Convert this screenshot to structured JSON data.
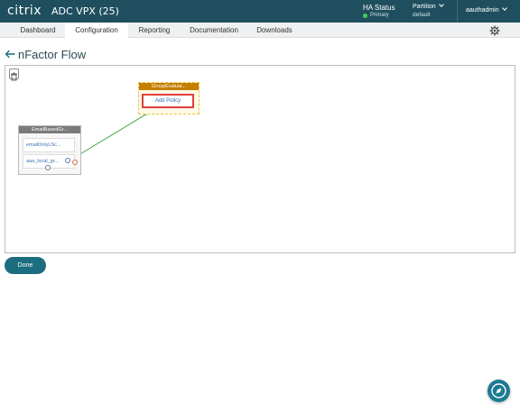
{
  "header": {
    "brand": "citrix",
    "product": "ADC VPX (25)",
    "ha_status": {
      "label": "HA Status",
      "state": "Primary"
    },
    "partition": {
      "label": "Partition",
      "value": "default"
    },
    "user": "aauthadmin"
  },
  "nav": {
    "tabs": [
      {
        "label": "Dashboard"
      },
      {
        "label": "Configuration"
      },
      {
        "label": "Reporting"
      },
      {
        "label": "Documentation"
      },
      {
        "label": "Downloads"
      }
    ]
  },
  "page": {
    "title": "nFactor Flow"
  },
  "flow": {
    "node_a": {
      "title": "EmailBasedGr...",
      "rows": [
        "emailOnlyLSc...",
        "aaa_local_gr..."
      ]
    },
    "node_b": {
      "title": "GroupEvaluat...",
      "action": "Add Policy"
    }
  },
  "actions": {
    "done": "Done"
  },
  "colors": {
    "topbar": "#1f4f5e",
    "accent": "#1c6d7f",
    "link": "#3aa83a",
    "highlight": "#e04040",
    "node_b_header": "#c47f00"
  }
}
